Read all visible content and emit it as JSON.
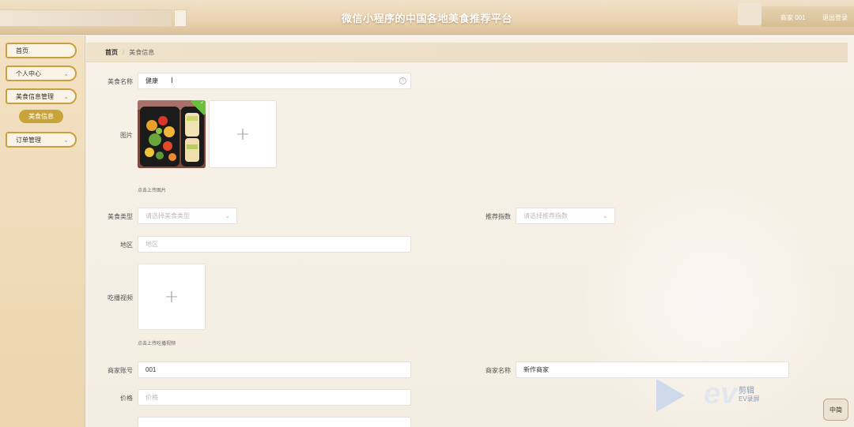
{
  "header": {
    "title": "微信小程序的中国各地美食推荐平台",
    "user_label": "商家 001",
    "logout_label": "退出登录"
  },
  "sidebar": {
    "items": [
      {
        "label": "首页",
        "has_chevron": false
      },
      {
        "label": "个人中心",
        "has_chevron": true
      },
      {
        "label": "美食信息管理",
        "has_chevron": true
      },
      {
        "label": "订单管理",
        "has_chevron": true
      }
    ],
    "active_sub_item": "美食信息"
  },
  "breadcrumb": {
    "home": "首页",
    "separator": "/",
    "current": "美食信息"
  },
  "form": {
    "food_name": {
      "label": "美食名称",
      "value": "健康"
    },
    "image": {
      "label": "图片",
      "hint": "点击上传图片"
    },
    "food_type": {
      "label": "美食类型",
      "placeholder": "请选择美食类型"
    },
    "recommend_index": {
      "label": "推荐指数",
      "placeholder": "请选择推荐指数"
    },
    "region": {
      "label": "地区",
      "placeholder": "地区"
    },
    "video": {
      "label": "吃播视频",
      "hint": "点击上传吃播视频"
    },
    "merchant_account": {
      "label": "商家账号",
      "value": "001"
    },
    "merchant_name": {
      "label": "商家名称",
      "value": "新作商家"
    },
    "price": {
      "label": "价格",
      "placeholder": "价格"
    }
  },
  "watermark": {
    "brand": "ev",
    "line1": "剪辑",
    "line2": "EV录屏"
  },
  "ime_indicator": "中简"
}
